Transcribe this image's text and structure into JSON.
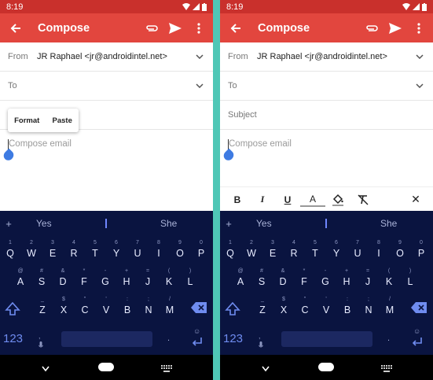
{
  "status": {
    "time": "8:19"
  },
  "appbar": {
    "title": "Compose"
  },
  "left": {
    "from_label": "From",
    "from_value": "JR Raphael <jr@androidintel.net>",
    "to_label": "To",
    "popup": {
      "format": "Format",
      "paste": "Paste"
    },
    "compose_placeholder": "Compose email"
  },
  "right": {
    "from_label": "From",
    "from_value": "JR Raphael <jr@androidintel.net>",
    "to_label": "To",
    "subject_label": "Subject",
    "compose_placeholder": "Compose email",
    "format_bar": {
      "bold": "B",
      "italic": "I",
      "underline": "U",
      "text_color": "A",
      "close": "✕"
    }
  },
  "keyboard": {
    "suggestions": {
      "plus": "+",
      "left": "Yes",
      "right": "She"
    },
    "row1": [
      {
        "sup": "1",
        "key": "Q"
      },
      {
        "sup": "2",
        "key": "W"
      },
      {
        "sup": "3",
        "key": "E"
      },
      {
        "sup": "4",
        "key": "R"
      },
      {
        "sup": "5",
        "key": "T"
      },
      {
        "sup": "6",
        "key": "Y"
      },
      {
        "sup": "7",
        "key": "U"
      },
      {
        "sup": "8",
        "key": "I"
      },
      {
        "sup": "9",
        "key": "O"
      },
      {
        "sup": "0",
        "key": "P"
      }
    ],
    "row2": [
      {
        "sup": "@",
        "key": "A"
      },
      {
        "sup": "#",
        "key": "S"
      },
      {
        "sup": "&",
        "key": "D"
      },
      {
        "sup": "*",
        "key": "F"
      },
      {
        "sup": "-",
        "key": "G"
      },
      {
        "sup": "+",
        "key": "H"
      },
      {
        "sup": "=",
        "key": "J"
      },
      {
        "sup": "(",
        "key": "K"
      },
      {
        "sup": ")",
        "key": "L"
      }
    ],
    "row3": [
      {
        "sup": "_",
        "key": "Z"
      },
      {
        "sup": "$",
        "key": "X"
      },
      {
        "sup": "\"",
        "key": "C"
      },
      {
        "sup": "'",
        "key": "V"
      },
      {
        "sup": ":",
        "key": "B"
      },
      {
        "sup": ";",
        "key": "N"
      },
      {
        "sup": "/",
        "key": "M"
      }
    ],
    "k123": "123",
    "mic_sup": ",",
    "emoji_sup": "☺",
    "dot": "."
  }
}
